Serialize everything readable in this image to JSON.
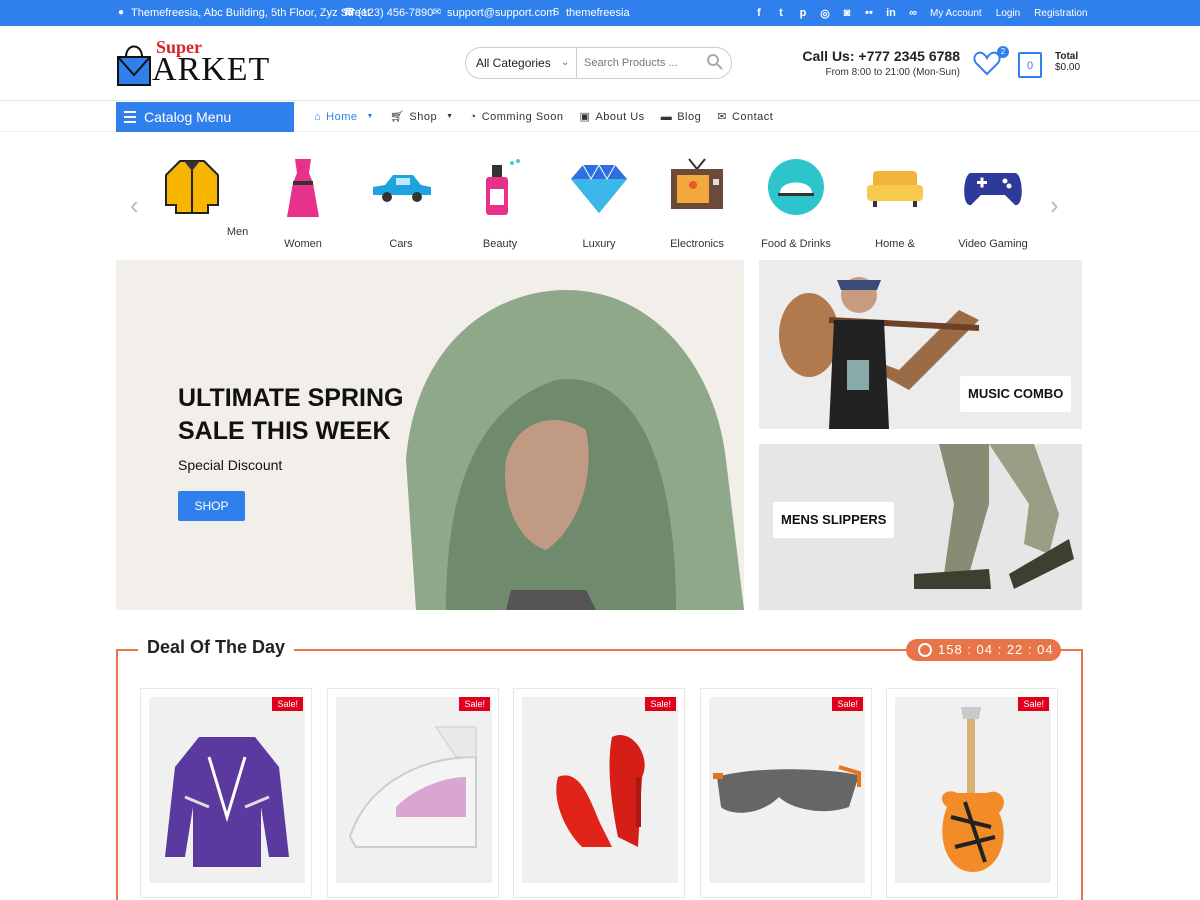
{
  "topbar": {
    "address": "Themefreesia, Abc Building, 5th Floor, Zyz Street",
    "phone": "(123) 456-7890",
    "email": "support@support.com",
    "skype": "themefreesia",
    "social_icons": [
      "facebook-icon",
      "twitter-icon",
      "pinterest-icon",
      "dribbble-icon",
      "instagram-icon",
      "flickr-icon",
      "linkedin-icon",
      "link-icon"
    ],
    "links": [
      "My Account",
      "Login",
      "Registration"
    ]
  },
  "header": {
    "logo_super": "Super",
    "logo_arket": "ARKET",
    "search_category": "All Categories",
    "search_placeholder": "Search Products ...",
    "call": "Call Us: +777 2345 6788",
    "hours": "From 8:00 to 21:00 (Mon-Sun)",
    "wishlist_count": "2",
    "cart_count": "0",
    "total_label": "Total",
    "total_value": "$0.00"
  },
  "nav": {
    "catalog": "Catalog Menu",
    "items": [
      "Home",
      "Shop",
      "Comming Soon",
      "About Us",
      "Blog",
      "Contact"
    ]
  },
  "categories": [
    "Men",
    "Women",
    "Cars",
    "Beauty",
    "Luxury",
    "Electronics",
    "Food & Drinks",
    "Home &",
    "Video Gaming"
  ],
  "hero": {
    "title_line1": "ULTIMATE SPRING",
    "title_line2": "SALE THIS WEEK",
    "subtitle": "Special Discount",
    "button": "SHOP"
  },
  "banners": [
    "MUSIC COMBO",
    "MENS SLIPPERS"
  ],
  "deal": {
    "title": "Deal Of The Day",
    "timer": "158 : 04 : 22 : 04",
    "sale_label": "Sale!"
  },
  "colors": {
    "accent": "#2f80ed",
    "deal": "#e8744a",
    "sale": "#e0001b"
  }
}
